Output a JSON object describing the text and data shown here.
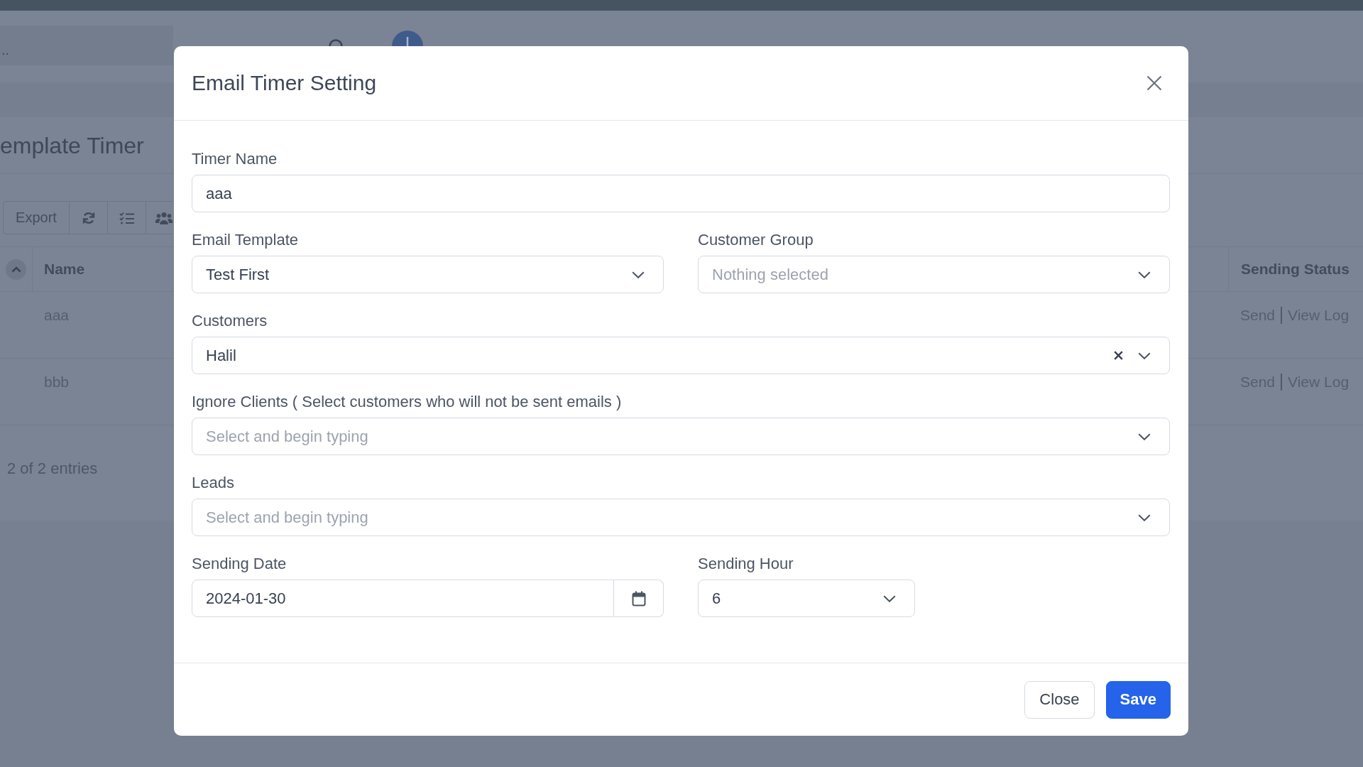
{
  "header": {
    "search": {
      "placeholder": ".."
    }
  },
  "page": {
    "title": "emplate Timer",
    "toolbar": {
      "export_label": "Export"
    },
    "table": {
      "columns": [
        "Name",
        "Sending Status"
      ],
      "rows": [
        {
          "name": "aaa",
          "actions": [
            "Send",
            "View Log"
          ]
        },
        {
          "name": "bbb",
          "actions": [
            "Send",
            "View Log"
          ]
        }
      ]
    },
    "entries_info": "2 of 2 entries"
  },
  "modal": {
    "title": "Email Timer Setting",
    "rows": [
      {
        "fields": [
          {
            "kind": "text",
            "label": "Timer Name",
            "value": "aaa"
          }
        ]
      },
      {
        "fields": [
          {
            "kind": "select",
            "label": "Email Template",
            "value": "Test First"
          },
          {
            "kind": "select",
            "label": "Customer Group",
            "placeholder": "Nothing selected"
          }
        ]
      },
      {
        "fields": [
          {
            "kind": "select",
            "label": "Customers",
            "value": "Halil",
            "clearable": true
          }
        ]
      },
      {
        "fields": [
          {
            "kind": "select",
            "label": "Ignore Clients ( Select customers who will not be sent emails )",
            "placeholder": "Select and begin typing"
          }
        ]
      },
      {
        "fields": [
          {
            "kind": "select",
            "label": "Leads",
            "placeholder": "Select and begin typing"
          }
        ]
      },
      {
        "fields": [
          {
            "kind": "date",
            "label": "Sending Date",
            "value": "2024-01-30"
          },
          {
            "kind": "select",
            "label": "Sending Hour",
            "value": "6"
          }
        ]
      }
    ],
    "buttons": [
      {
        "kind": "secondary",
        "label": "Close"
      },
      {
        "kind": "primary",
        "label": "Save"
      }
    ]
  }
}
